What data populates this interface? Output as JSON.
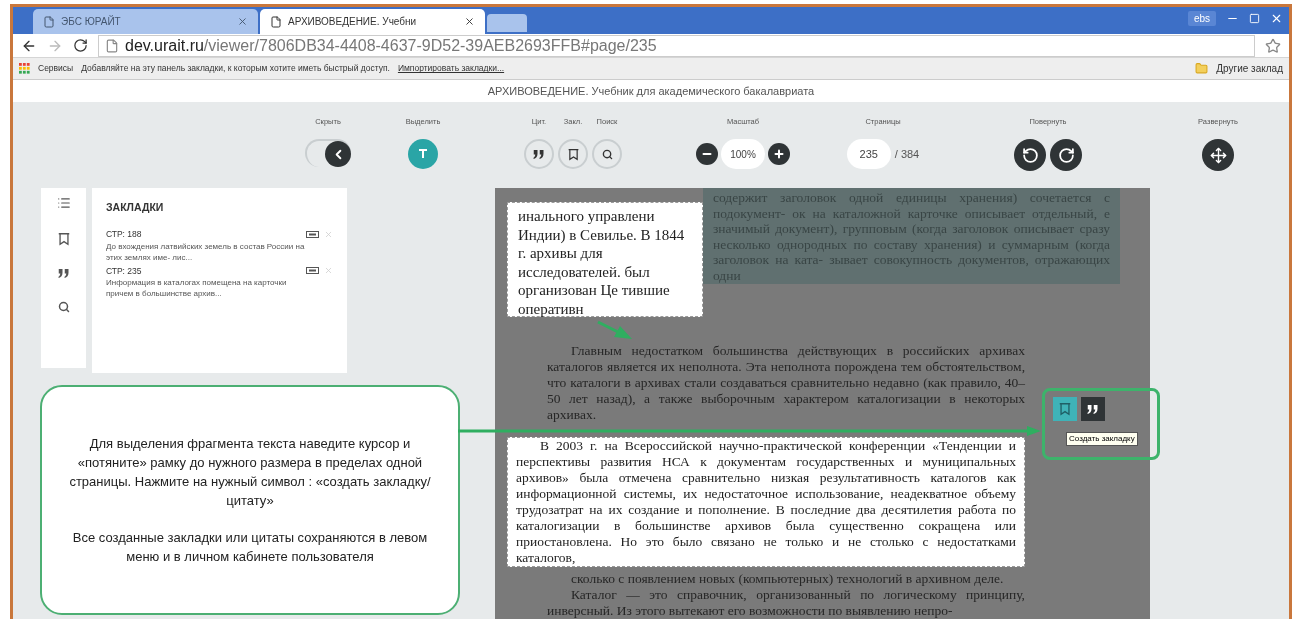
{
  "browser": {
    "tabs": [
      {
        "label": "ЭБС ЮРАЙТ",
        "selected": false
      },
      {
        "label": "АРХИВОВЕДЕНИЕ. Учебни",
        "selected": true
      }
    ],
    "profile": "ebs",
    "address": {
      "host": "dev.urait.ru",
      "path": "/viewer/7806DB34-4408-4637-9D52-39AEB2693FFB#page/235"
    },
    "bookmarks_bar": {
      "apps": "Сервисы",
      "hint": "Добавляйте на эту панель закладки, к которым хотите иметь быстрый доступ.",
      "import_link": "Импортировать закладки...",
      "other": "Другие заклад"
    }
  },
  "viewer": {
    "title": "АРХИВОВЕДЕНИЕ. Учебник для академического бакалавриата",
    "toolbar": [
      {
        "kind": "toggle",
        "label": "Скрыть",
        "on": true
      },
      {
        "kind": "highlight",
        "label": "Выделить",
        "selected": true
      },
      {
        "kind": "tools",
        "tools": [
          {
            "label": "Цит."
          },
          {
            "label": "Закл."
          },
          {
            "label": "Поиск"
          }
        ]
      },
      {
        "kind": "zoom",
        "label": "Масштаб",
        "value": "100%"
      },
      {
        "kind": "pages",
        "label": "Страницы",
        "value": "235",
        "total": "/ 384"
      },
      {
        "kind": "rotate",
        "label": "Повернуть"
      },
      {
        "kind": "expand",
        "label": "Развернуть"
      }
    ],
    "panel": {
      "title": "ЗАКЛАДКИ",
      "items": [
        {
          "page": "СТР: 188",
          "text": "До вхождения латвийских земель в состав России на этих землях име- лис..."
        },
        {
          "page": "СТР: 235",
          "text": "Информация в каталогах помещена на карточки причем в большинстве архив..."
        }
      ]
    },
    "page": {
      "selection_top": "инального управлени Индии) в Севилье. В 1844 г. архивы для исследователей. был организован Це тившие оперативн",
      "dimmed_top": "содержит заголовок одной единицы хранения) сочетается с подокумент- ок на каталожной карточке описывает отдельный, е значимый документ), групповым (когда заголовок описывает сразу несколько однородных по составу хранения) и суммарным (когда заголовок на ката- зывает совокупность документов, отражающих одни",
      "paragraphs": [
        {
          "text": "Главным недостатком большинства действующих в российских архивах каталогов является их неполнота. Эта неполнота порождена тем обстоятельством, что каталоги в архивах стали создаваться сравнительно недавно (как правило, 40–50 лет назад), а также выборочным характером каталогизации в некоторых архивах.",
          "selected": false
        },
        {
          "text": "В 2003 г. на Всероссийской научно-практической конференции «Тенденции и перспективы развития НСА к документам государственных и муниципальных архивов» была отмечена сравнительно низкая результативность каталогов как информационной системы, их недостаточное использование, неадекватное объему трудозатрат на их создание и пополнение. В последние два десятилетия работа по каталогизации в большинстве архивов была существенно сокращена или приостановлена. Но это было связано не только и не столько с недостатками каталогов,",
          "selected": true
        },
        {
          "text": "сколько с появлением новых (компьютерных) технологий в архивном деле.",
          "selected": false
        },
        {
          "text": "Каталог — это справочник, организованный по логическому принципу, инверсный. Из этого вытекают его возможности по выявлению непро-",
          "selected": false
        }
      ],
      "actions": [
        {
          "hovered": true
        },
        {
          "hovered": false
        }
      ],
      "tooltip": "Создать закладку"
    }
  },
  "callout": {
    "paragraphs": [
      "Для выделения фрагмента текста наведите курсор и «потяните» рамку до нужного размера в пределах одной страницы. Нажмите на нужный символ : «создать закладку/цитату»",
      "Все созданные закладки или цитаты сохраняются в левом меню и в личном кабинете пользователя"
    ]
  }
}
